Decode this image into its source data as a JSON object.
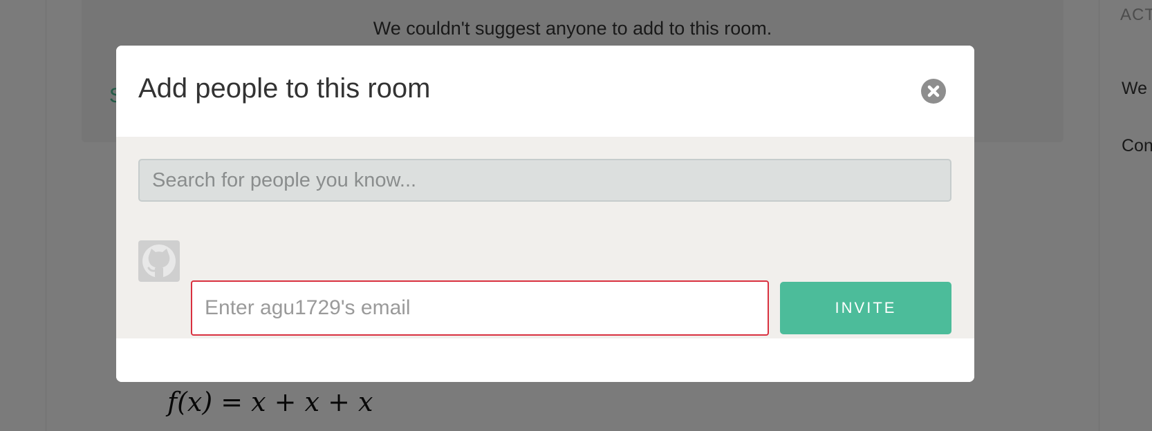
{
  "background": {
    "suggestion_text": "We couldn't suggest anyone to add to this room.",
    "suggestion_link": "S",
    "formula": "f(x) = x + x + x",
    "right_panel": {
      "header": "ACT",
      "line1": "We l",
      "line2": "Con"
    }
  },
  "modal": {
    "title": "Add people to this room",
    "close_icon": "close-circle-icon",
    "search": {
      "placeholder": "Search for people you know...",
      "value": ""
    },
    "invite_row": {
      "avatar_icon": "github-octocat-icon",
      "email_placeholder": "Enter agu1729's email",
      "email_value": "",
      "invite_label": "INVITE"
    }
  },
  "colors": {
    "accent": "#4cbc9a",
    "error_border": "#d9303f",
    "overlay": "rgba(0,0,0,0.5)"
  }
}
